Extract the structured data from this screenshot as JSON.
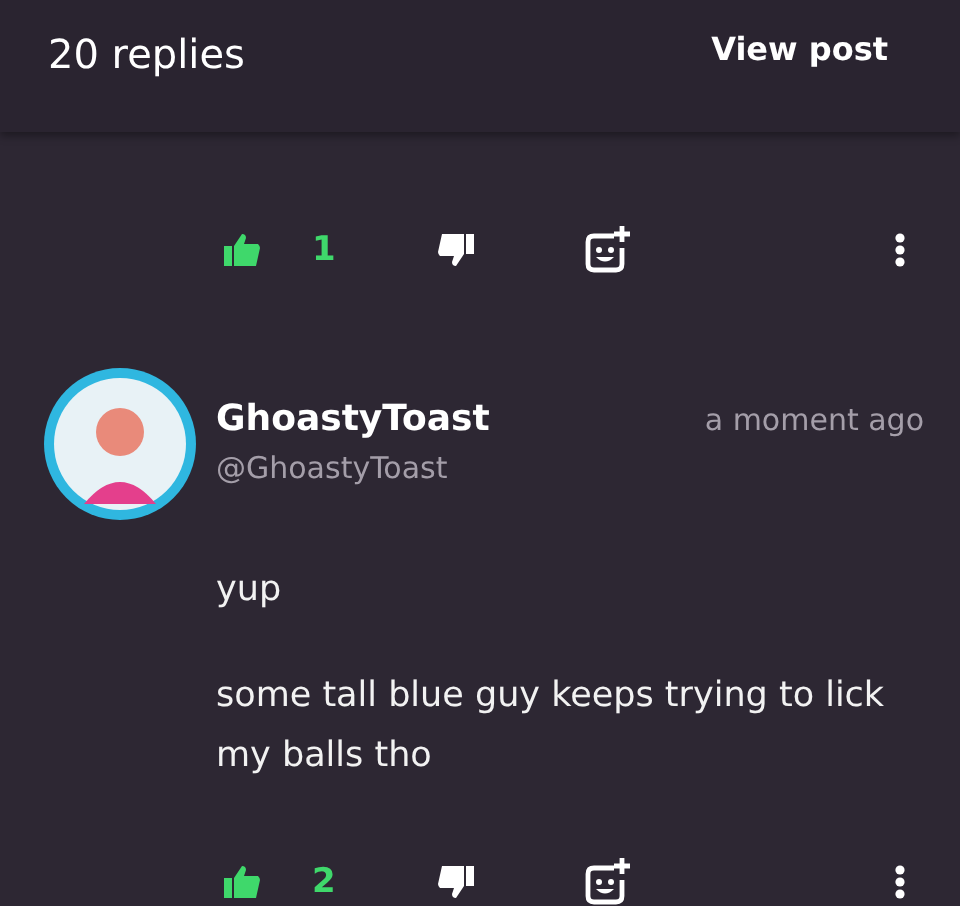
{
  "header": {
    "title": "20 replies",
    "action": "View post"
  },
  "comments": [
    {
      "kind": "partial",
      "likes": "1",
      "liked": true
    },
    {
      "kind": "full",
      "author": "GhoastyToast",
      "handle": "@GhoastyToast",
      "time": "a moment ago",
      "paragraphs": [
        "yup",
        "some tall blue guy keeps trying to lick my balls tho"
      ],
      "likes": "2",
      "liked": true
    }
  ]
}
